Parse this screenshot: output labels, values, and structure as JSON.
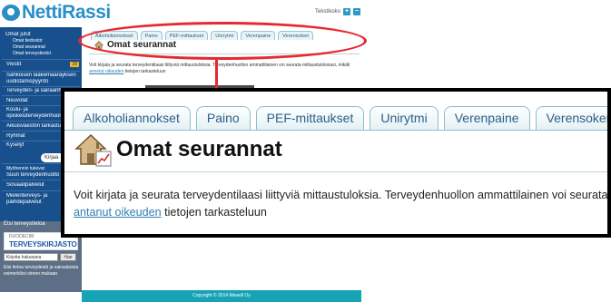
{
  "header": {
    "logo_text": "NettiRassi",
    "text_size_label": "Tekstikoko",
    "text_size_plus": "+",
    "text_size_minus": "−"
  },
  "sidebar": {
    "items": [
      {
        "label": "Omat jutut"
      },
      {
        "label": "Omat tiedostot"
      },
      {
        "label": "Omat seurannat"
      },
      {
        "label": "Omat terveystiedot"
      },
      {
        "label": "Viestit",
        "badge": "28"
      },
      {
        "label": "Sähköisen lääkemääräyksen"
      },
      {
        "label": "uudistamispyyntö"
      },
      {
        "label": "Terveyden- ja sairaanhoito"
      },
      {
        "label": "Neuvolat"
      },
      {
        "label": "Koulu- ja"
      },
      {
        "label": "opiskeluterveydenhuolto"
      },
      {
        "label": "Aikuisväestön tarkastukset"
      },
      {
        "label": "Ryhmät"
      },
      {
        "label": "Kyselyt"
      },
      {
        "label": "Myöhennin tukevat"
      },
      {
        "label": "Suun terveydenhuolto"
      },
      {
        "label": "Sosiaalipalvelut"
      },
      {
        "label": "Mielenterveys- ja"
      },
      {
        "label": "päihdepalvelut"
      }
    ],
    "search_pill": "Kirjaa",
    "bottom": {
      "title": "Etsi terveystietoa",
      "duodecim_small": "DUODECIM",
      "duodecim_big": "TERVEYSKIRJASTO",
      "search_placeholder": "Kirjoita hakusana",
      "search_button": "Hae",
      "description": "Etsi tietoa terveydestä ja sairauksista esimerkiksi oireen mukaan"
    }
  },
  "tabs": [
    "Alkoholiannokset",
    "Paino",
    "PEF-mittaukset",
    "Unirytmi",
    "Verenpaine",
    "Verensokeri"
  ],
  "page_title": "Omat seurannat",
  "small_description": {
    "line1": "Voit kirjata ja seurata terveydentilaasi liittyviä mittaustuloksia. Terveydenhuollon ammattilainen voi seurata mittaustuloksiasi, mikäli",
    "line2_prefix": "",
    "link": "annetut oikeuden",
    "line2_suffix": "tietojen tarkasteluun"
  },
  "zoom_description": {
    "line1": "Voit kirjata ja seurata terveydentilaasi liittyviä mittaustuloksia. Terveydenhuollon ammattilainen voi seurata mitta",
    "link": "antanut oikeuden",
    "line2_suffix": " tietojen tarkasteluun"
  },
  "footer": {
    "text": "Copyright © 2014 Mawell Oy"
  },
  "colors": {
    "brand": "#2a8fc9",
    "sidebar": "#17508d",
    "footer": "#16a3b6",
    "annotation": "#e8282f",
    "tab_text": "#2b5f8a"
  }
}
